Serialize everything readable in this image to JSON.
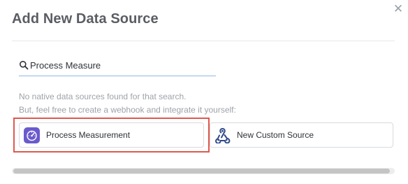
{
  "dialog": {
    "title": "Add New Data Source",
    "close_icon": "close-icon"
  },
  "search": {
    "icon": "search-icon",
    "value": "Process Measure",
    "placeholder": ""
  },
  "messages": {
    "line1": "No native data sources found for that search.",
    "line2": "But, feel free to create a webhook and integrate it yourself:"
  },
  "results": [
    {
      "label": "Process Measurement",
      "icon": "process-measurement-icon",
      "highlighted": true
    },
    {
      "label": "New Custom Source",
      "icon": "webhook-icon",
      "highlighted": false
    }
  ],
  "colors": {
    "title": "#5a5d63",
    "highlight": "#e0584f",
    "search_underline": "#8fb8e6",
    "process_icon_bg": "#6a5acd"
  }
}
